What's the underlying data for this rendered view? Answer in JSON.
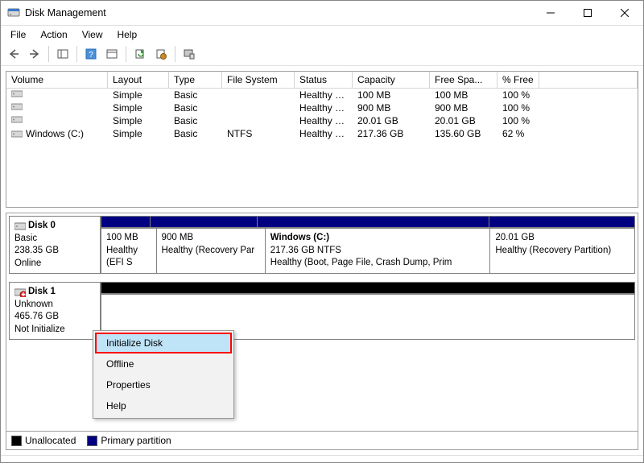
{
  "window": {
    "title": "Disk Management"
  },
  "menu": {
    "file": "File",
    "action": "Action",
    "view": "View",
    "help": "Help"
  },
  "toolbar_icons": [
    "back",
    "forward",
    "show-hide",
    "help",
    "properties",
    "refresh",
    "rescan",
    "more"
  ],
  "vol_table": {
    "headers": {
      "volume": "Volume",
      "layout": "Layout",
      "type": "Type",
      "fs": "File System",
      "status": "Status",
      "capacity": "Capacity",
      "free": "Free Spa...",
      "pct": "% Free"
    },
    "rows": [
      {
        "volume": "",
        "layout": "Simple",
        "type": "Basic",
        "fs": "",
        "status": "Healthy (E...",
        "capacity": "100 MB",
        "free": "100 MB",
        "pct": "100 %"
      },
      {
        "volume": "",
        "layout": "Simple",
        "type": "Basic",
        "fs": "",
        "status": "Healthy (R...",
        "capacity": "900 MB",
        "free": "900 MB",
        "pct": "100 %"
      },
      {
        "volume": "",
        "layout": "Simple",
        "type": "Basic",
        "fs": "",
        "status": "Healthy (R...",
        "capacity": "20.01 GB",
        "free": "20.01 GB",
        "pct": "100 %"
      },
      {
        "volume": "Windows (C:)",
        "layout": "Simple",
        "type": "Basic",
        "fs": "NTFS",
        "status": "Healthy (B...",
        "capacity": "217.36 GB",
        "free": "135.60 GB",
        "pct": "62 %"
      }
    ]
  },
  "graph": {
    "disk0": {
      "name": "Disk 0",
      "type": "Basic",
      "size": "238.35 GB",
      "state": "Online",
      "parts": [
        {
          "title": "",
          "size": "100 MB",
          "status": "Healthy (EFI S",
          "flex": 10
        },
        {
          "title": "",
          "size": "900 MB",
          "status": "Healthy (Recovery Par",
          "flex": 22
        },
        {
          "title": "Windows  (C:)",
          "size": "217.36 GB NTFS",
          "status": "Healthy (Boot, Page File, Crash Dump, Prim",
          "flex": 48
        },
        {
          "title": "",
          "size": "20.01 GB",
          "status": "Healthy (Recovery Partition)",
          "flex": 30
        }
      ]
    },
    "disk1": {
      "name": "Disk 1",
      "type": "Unknown",
      "size": "465.76 GB",
      "state": "Not Initialize"
    }
  },
  "legend": {
    "unallocated": "Unallocated",
    "primary": "Primary partition"
  },
  "ctx": {
    "init": "Initialize Disk",
    "offline": "Offline",
    "props": "Properties",
    "help": "Help"
  }
}
